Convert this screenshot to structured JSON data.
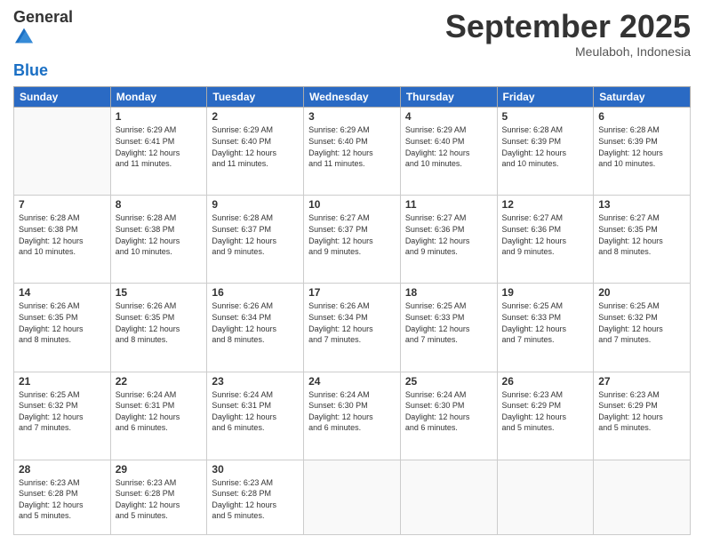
{
  "header": {
    "logo_general": "General",
    "logo_blue": "Blue",
    "month_title": "September 2025",
    "location": "Meulaboh, Indonesia"
  },
  "weekdays": [
    "Sunday",
    "Monday",
    "Tuesday",
    "Wednesday",
    "Thursday",
    "Friday",
    "Saturday"
  ],
  "weeks": [
    [
      {
        "day": "",
        "content": ""
      },
      {
        "day": "1",
        "content": "Sunrise: 6:29 AM\nSunset: 6:41 PM\nDaylight: 12 hours\nand 11 minutes."
      },
      {
        "day": "2",
        "content": "Sunrise: 6:29 AM\nSunset: 6:40 PM\nDaylight: 12 hours\nand 11 minutes."
      },
      {
        "day": "3",
        "content": "Sunrise: 6:29 AM\nSunset: 6:40 PM\nDaylight: 12 hours\nand 11 minutes."
      },
      {
        "day": "4",
        "content": "Sunrise: 6:29 AM\nSunset: 6:40 PM\nDaylight: 12 hours\nand 10 minutes."
      },
      {
        "day": "5",
        "content": "Sunrise: 6:28 AM\nSunset: 6:39 PM\nDaylight: 12 hours\nand 10 minutes."
      },
      {
        "day": "6",
        "content": "Sunrise: 6:28 AM\nSunset: 6:39 PM\nDaylight: 12 hours\nand 10 minutes."
      }
    ],
    [
      {
        "day": "7",
        "content": "Sunrise: 6:28 AM\nSunset: 6:38 PM\nDaylight: 12 hours\nand 10 minutes."
      },
      {
        "day": "8",
        "content": "Sunrise: 6:28 AM\nSunset: 6:38 PM\nDaylight: 12 hours\nand 10 minutes."
      },
      {
        "day": "9",
        "content": "Sunrise: 6:28 AM\nSunset: 6:37 PM\nDaylight: 12 hours\nand 9 minutes."
      },
      {
        "day": "10",
        "content": "Sunrise: 6:27 AM\nSunset: 6:37 PM\nDaylight: 12 hours\nand 9 minutes."
      },
      {
        "day": "11",
        "content": "Sunrise: 6:27 AM\nSunset: 6:36 PM\nDaylight: 12 hours\nand 9 minutes."
      },
      {
        "day": "12",
        "content": "Sunrise: 6:27 AM\nSunset: 6:36 PM\nDaylight: 12 hours\nand 9 minutes."
      },
      {
        "day": "13",
        "content": "Sunrise: 6:27 AM\nSunset: 6:35 PM\nDaylight: 12 hours\nand 8 minutes."
      }
    ],
    [
      {
        "day": "14",
        "content": "Sunrise: 6:26 AM\nSunset: 6:35 PM\nDaylight: 12 hours\nand 8 minutes."
      },
      {
        "day": "15",
        "content": "Sunrise: 6:26 AM\nSunset: 6:35 PM\nDaylight: 12 hours\nand 8 minutes."
      },
      {
        "day": "16",
        "content": "Sunrise: 6:26 AM\nSunset: 6:34 PM\nDaylight: 12 hours\nand 8 minutes."
      },
      {
        "day": "17",
        "content": "Sunrise: 6:26 AM\nSunset: 6:34 PM\nDaylight: 12 hours\nand 7 minutes."
      },
      {
        "day": "18",
        "content": "Sunrise: 6:25 AM\nSunset: 6:33 PM\nDaylight: 12 hours\nand 7 minutes."
      },
      {
        "day": "19",
        "content": "Sunrise: 6:25 AM\nSunset: 6:33 PM\nDaylight: 12 hours\nand 7 minutes."
      },
      {
        "day": "20",
        "content": "Sunrise: 6:25 AM\nSunset: 6:32 PM\nDaylight: 12 hours\nand 7 minutes."
      }
    ],
    [
      {
        "day": "21",
        "content": "Sunrise: 6:25 AM\nSunset: 6:32 PM\nDaylight: 12 hours\nand 7 minutes."
      },
      {
        "day": "22",
        "content": "Sunrise: 6:24 AM\nSunset: 6:31 PM\nDaylight: 12 hours\nand 6 minutes."
      },
      {
        "day": "23",
        "content": "Sunrise: 6:24 AM\nSunset: 6:31 PM\nDaylight: 12 hours\nand 6 minutes."
      },
      {
        "day": "24",
        "content": "Sunrise: 6:24 AM\nSunset: 6:30 PM\nDaylight: 12 hours\nand 6 minutes."
      },
      {
        "day": "25",
        "content": "Sunrise: 6:24 AM\nSunset: 6:30 PM\nDaylight: 12 hours\nand 6 minutes."
      },
      {
        "day": "26",
        "content": "Sunrise: 6:23 AM\nSunset: 6:29 PM\nDaylight: 12 hours\nand 5 minutes."
      },
      {
        "day": "27",
        "content": "Sunrise: 6:23 AM\nSunset: 6:29 PM\nDaylight: 12 hours\nand 5 minutes."
      }
    ],
    [
      {
        "day": "28",
        "content": "Sunrise: 6:23 AM\nSunset: 6:28 PM\nDaylight: 12 hours\nand 5 minutes."
      },
      {
        "day": "29",
        "content": "Sunrise: 6:23 AM\nSunset: 6:28 PM\nDaylight: 12 hours\nand 5 minutes."
      },
      {
        "day": "30",
        "content": "Sunrise: 6:23 AM\nSunset: 6:28 PM\nDaylight: 12 hours\nand 5 minutes."
      },
      {
        "day": "",
        "content": ""
      },
      {
        "day": "",
        "content": ""
      },
      {
        "day": "",
        "content": ""
      },
      {
        "day": "",
        "content": ""
      }
    ]
  ]
}
